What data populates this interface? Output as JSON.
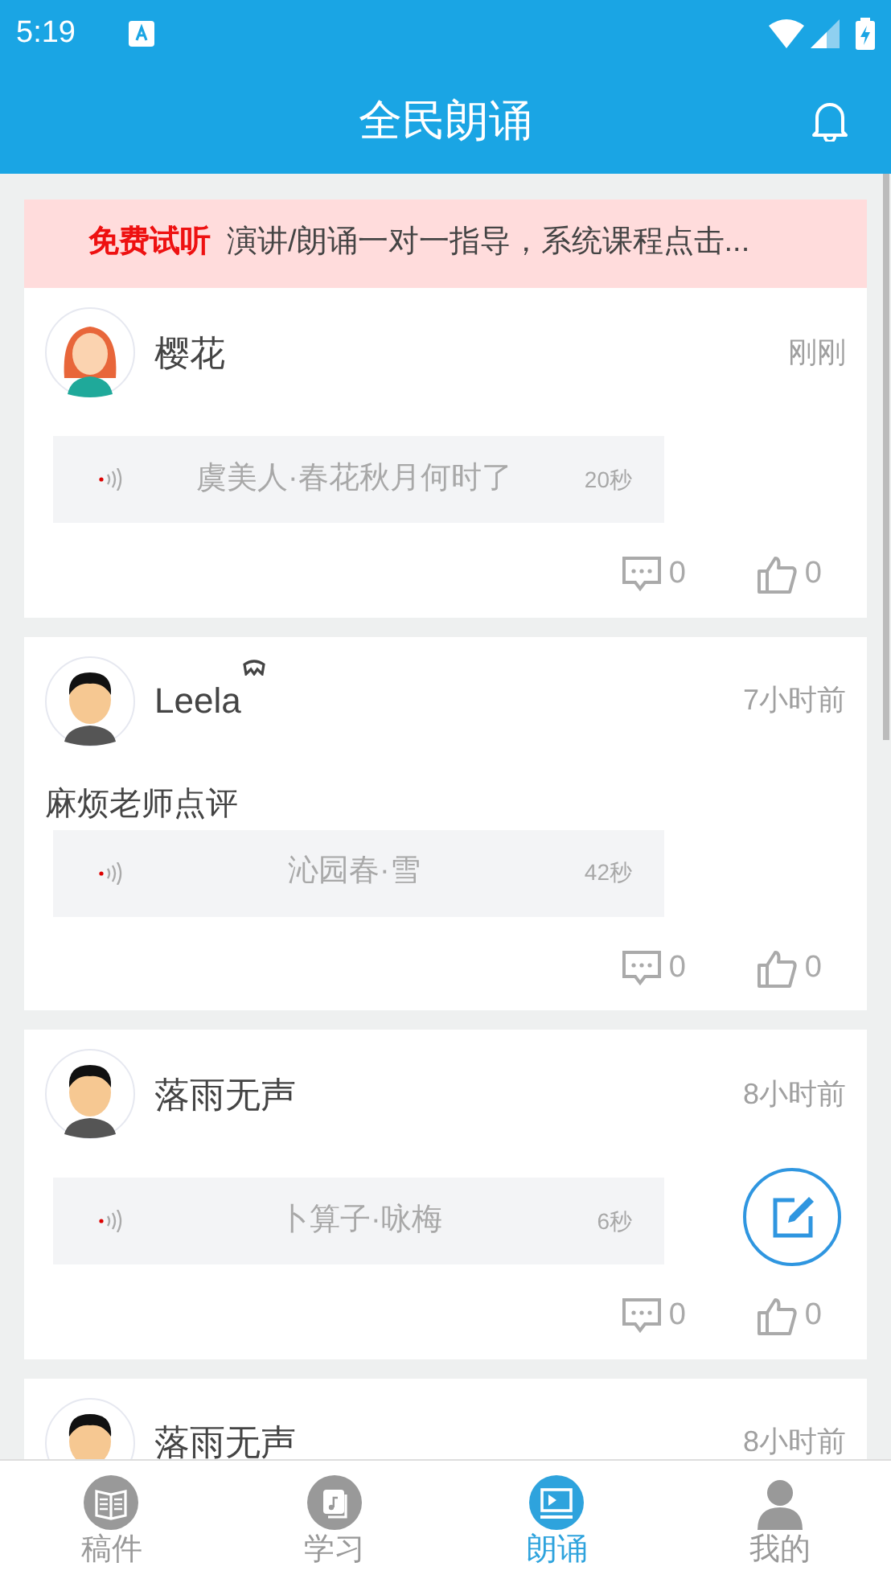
{
  "status_bar": {
    "time": "5:19"
  },
  "header": {
    "title": "全民朗诵"
  },
  "banner": {
    "highlight": "免费试听",
    "text": "演讲/朗诵一对一指导，系统课程点击..."
  },
  "posts": [
    {
      "kind": "female",
      "name": "樱花",
      "badge": false,
      "time": "刚刚",
      "audio": {
        "title": "虞美人·春花秋月何时了",
        "duration": "20秒"
      },
      "comments": "0",
      "likes": "0"
    },
    {
      "kind": "male",
      "name": "Leela",
      "badge": true,
      "time": "7小时前",
      "text": "麻烦老师点评",
      "audio": {
        "title": "沁园春·雪",
        "duration": "42秒"
      },
      "comments": "0",
      "likes": "0"
    },
    {
      "kind": "male",
      "name": "落雨无声",
      "badge": false,
      "time": "8小时前",
      "audio": {
        "title": "卜算子·咏梅",
        "duration": "6秒"
      },
      "comments": "0",
      "likes": "0"
    },
    {
      "kind": "male",
      "name": "落雨无声",
      "badge": false,
      "time": "8小时前"
    }
  ],
  "tabs": [
    {
      "label": "稿件",
      "kind": "book",
      "selected": false
    },
    {
      "label": "学习",
      "kind": "music",
      "selected": false
    },
    {
      "label": "朗诵",
      "kind": "screen",
      "selected": true
    },
    {
      "label": "我的",
      "kind": "person",
      "selected": false
    }
  ]
}
